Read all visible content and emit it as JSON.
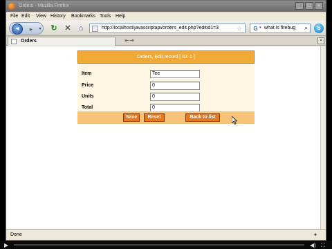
{
  "window": {
    "title": "Orders - Mozilla Firefox"
  },
  "menubar": {
    "items": [
      "File",
      "Edit",
      "View",
      "History",
      "Bookmarks",
      "Tools",
      "Help"
    ]
  },
  "navbar": {
    "url": "http://localhost/javascriptapi/orders_edit.php?editid1=3",
    "search_value": "what is firebug"
  },
  "tab": {
    "label": "Orders"
  },
  "form": {
    "header": "Orders, Edit record [ ID: 1 ]",
    "fields": [
      {
        "label": "Item",
        "value": "Tee"
      },
      {
        "label": "Price",
        "value": "0"
      },
      {
        "label": "Units",
        "value": "0"
      },
      {
        "label": "Total",
        "value": "0"
      }
    ],
    "buttons": {
      "save": "Save",
      "reset": "Reset",
      "back": "Back to list"
    }
  },
  "status": {
    "text": "Done"
  },
  "player": {
    "progress": 0.0
  },
  "colors": {
    "accent": "#f0a935",
    "button": "#e8771c",
    "form_bg": "#fdf6e3"
  },
  "icons": {
    "back": "back-arrow-icon",
    "forward": "forward-arrow-icon",
    "reload": "reload-icon",
    "stop": "stop-icon",
    "home": "home-icon",
    "search": "magnifier-icon"
  }
}
